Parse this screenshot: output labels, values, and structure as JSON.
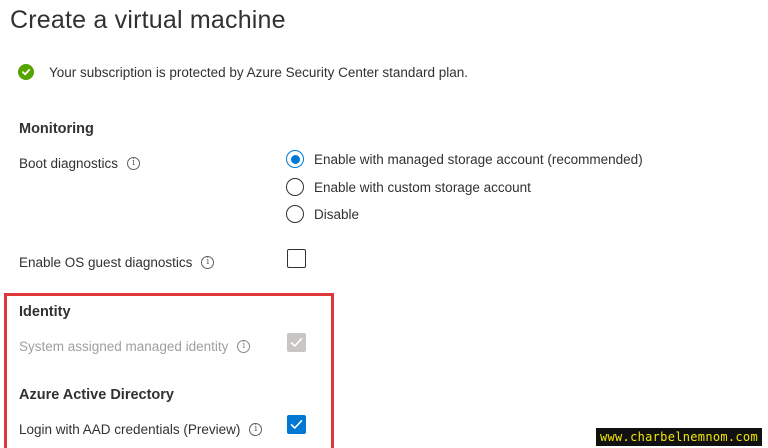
{
  "page": {
    "title": "Create a virtual machine"
  },
  "notice": {
    "icon": "checkmark-circle-icon",
    "status_color": "#57a300",
    "text": "Your subscription is protected by Azure Security Center standard plan."
  },
  "monitoring": {
    "heading": "Monitoring",
    "boot_diagnostics": {
      "label": "Boot diagnostics",
      "options": [
        {
          "label": "Enable with managed storage account (recommended)",
          "selected": true
        },
        {
          "label": "Enable with custom storage account",
          "selected": false
        },
        {
          "label": "Disable",
          "selected": false
        }
      ]
    },
    "os_guest_diagnostics": {
      "label": "Enable OS guest diagnostics",
      "checked": false
    }
  },
  "identity": {
    "heading": "Identity",
    "system_assigned": {
      "label": "System assigned managed identity",
      "checked": true,
      "disabled": true
    }
  },
  "aad": {
    "heading": "Azure Active Directory",
    "login": {
      "label": "Login with AAD credentials (Preview)",
      "checked": true
    }
  },
  "watermark": {
    "text": "www.charbelnemnom.com"
  },
  "colors": {
    "accent": "#0078d4",
    "highlight": "#e0383a"
  }
}
